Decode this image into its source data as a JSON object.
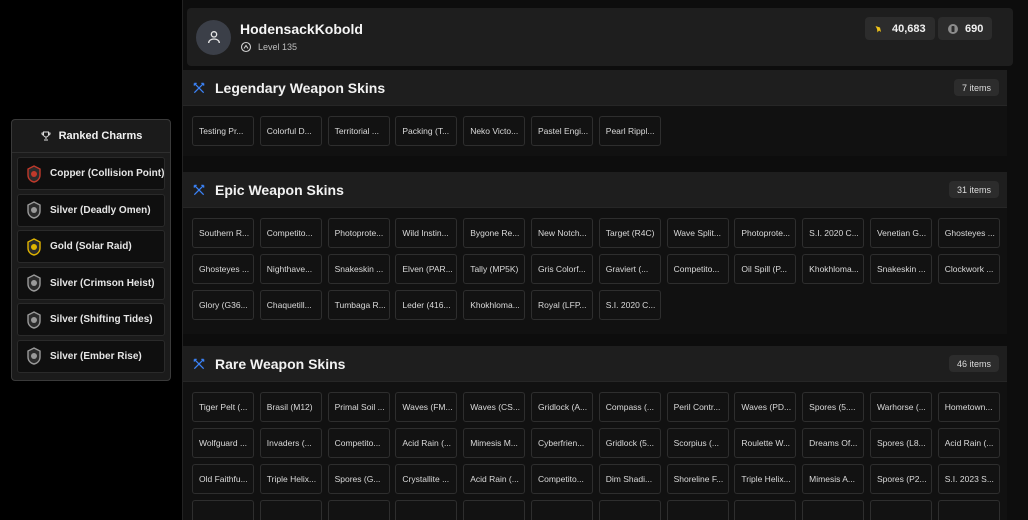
{
  "charms": {
    "title": "Ranked Charms",
    "items": [
      {
        "label": "Copper (Collision Point)",
        "color": "#c0392b"
      },
      {
        "label": "Silver (Deadly Omen)",
        "color": "#9a9a9a"
      },
      {
        "label": "Gold (Solar Raid)",
        "color": "#e0b400"
      },
      {
        "label": "Silver (Crimson Heist)",
        "color": "#9a9a9a"
      },
      {
        "label": "Silver (Shifting Tides)",
        "color": "#9a9a9a"
      },
      {
        "label": "Silver (Ember Rise)",
        "color": "#9a9a9a"
      }
    ]
  },
  "profile": {
    "username": "HodensackKobold",
    "level": "Level 135",
    "renown": "40,683",
    "credits": "690"
  },
  "colors": {
    "accent": "#3b82f6",
    "renown": "#f0c419"
  },
  "sections": [
    {
      "title": "Legendary Weapon Skins",
      "count": "7 items",
      "items": [
        "Testing Pr...",
        "Colorful D...",
        "Territorial ...",
        "Packing (T...",
        "Neko Victo...",
        "Pastel Engi...",
        "Pearl Rippl..."
      ]
    },
    {
      "title": "Epic Weapon Skins",
      "count": "31 items",
      "items": [
        "Southern R...",
        "Competito...",
        "Photoprote...",
        "Wild Instin...",
        "Bygone Re...",
        "New Notch...",
        "Target (R4C)",
        "Wave Split...",
        "Photoprote...",
        "S.I. 2020 C...",
        "Venetian G...",
        "Ghosteyes ...",
        "Ghosteyes ...",
        "Nighthave...",
        "Snakeskin ...",
        "Elven (PAR...",
        "Tally (MP5K)",
        "Gris Colorf...",
        "Graviert (...",
        "Competito...",
        "Oil Spill (P...",
        "Khokhloma...",
        "Snakeskin ...",
        "Clockwork ...",
        "Glory (G36...",
        "Chaquetill...",
        "Tumbaga R...",
        "Leder (416...",
        "Khokhloma...",
        "Royal (LFP...",
        "S.I. 2020 C..."
      ]
    },
    {
      "title": "Rare Weapon Skins",
      "count": "46 items",
      "items": [
        "Tiger Pelt (...",
        "Brasil (M12)",
        "Primal Soil ...",
        "Waves (FM...",
        "Waves (CS...",
        "Gridlock (A...",
        "Compass (...",
        "Peril Contr...",
        "Waves (PD...",
        "Spores (5....",
        "Warhorse (...",
        "Hometown...",
        "Wolfguard ...",
        "Invaders (...",
        "Competito...",
        "Acid Rain (...",
        "Mimesis M...",
        "Cyberfrien...",
        "Gridlock (5...",
        "Scorpius (...",
        "Roulette W...",
        "Dreams Of...",
        "Spores (L8...",
        "Acid Rain (...",
        "Old Faithfu...",
        "Triple Helix...",
        "Spores (G...",
        "Crystallite ...",
        "Acid Rain (...",
        "Competito...",
        "Dim Shadi...",
        "Shoreline F...",
        "Triple Helix...",
        "Mimesis A...",
        "Spores (P2...",
        "S.I. 2023 S...",
        "",
        "",
        "",
        "",
        "",
        "",
        "",
        "",
        "",
        "",
        "",
        ""
      ]
    }
  ]
}
